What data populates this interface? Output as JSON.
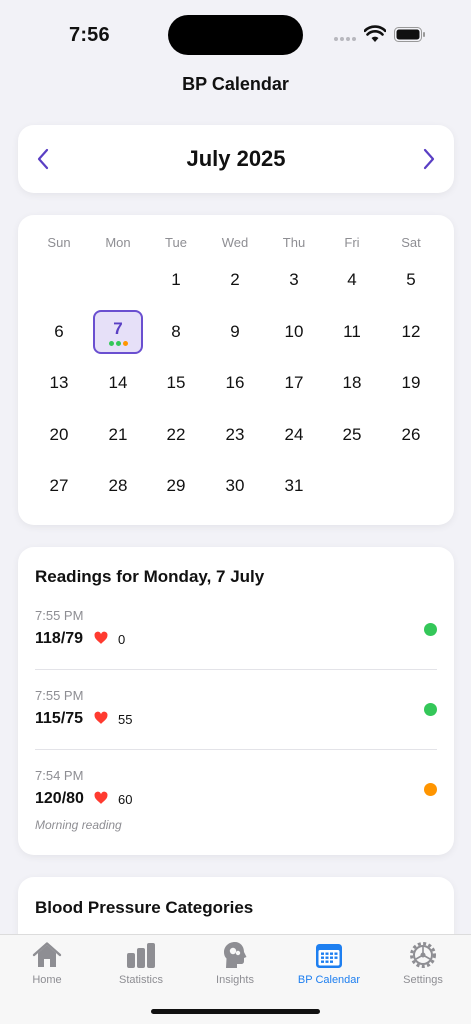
{
  "status_bar": {
    "time": "7:56"
  },
  "nav": {
    "title": "BP Calendar"
  },
  "month": {
    "label": "July 2025"
  },
  "calendar": {
    "weekdays": [
      "Sun",
      "Mon",
      "Tue",
      "Wed",
      "Thu",
      "Fri",
      "Sat"
    ],
    "days": [
      "1",
      "2",
      "3",
      "4",
      "5",
      "6",
      "7",
      "8",
      "9",
      "10",
      "11",
      "12",
      "13",
      "14",
      "15",
      "16",
      "17",
      "18",
      "19",
      "20",
      "21",
      "22",
      "23",
      "24",
      "25",
      "26",
      "27",
      "28",
      "29",
      "30",
      "31"
    ],
    "selected_day": "7",
    "selected_dot_colors": [
      "#34c759",
      "#34c759",
      "#ff9500"
    ]
  },
  "readings": {
    "title": "Readings for Monday, 7 July",
    "items": [
      {
        "time": "7:55 PM",
        "bp": "118/79",
        "heart_rate": "0",
        "status_color": "#34c759",
        "note": ""
      },
      {
        "time": "7:55 PM",
        "bp": "115/75",
        "heart_rate": "55",
        "status_color": "#34c759",
        "note": ""
      },
      {
        "time": "7:54 PM",
        "bp": "120/80",
        "heart_rate": "60",
        "status_color": "#ff9500",
        "note": "Morning reading"
      }
    ]
  },
  "categories": {
    "title": "Blood Pressure Categories"
  },
  "tabs": [
    {
      "label": "Home",
      "icon": "house-icon",
      "active": false
    },
    {
      "label": "Statistics",
      "icon": "bar-chart-icon",
      "active": false
    },
    {
      "label": "Insights",
      "icon": "brain-head-icon",
      "active": false
    },
    {
      "label": "BP Calendar",
      "icon": "calendar-icon",
      "active": true
    },
    {
      "label": "Settings",
      "icon": "gear-icon",
      "active": false
    }
  ],
  "colors": {
    "accent": "#5a3fc4",
    "tab_active": "#1e7ff0",
    "heart": "#ff3b30"
  }
}
